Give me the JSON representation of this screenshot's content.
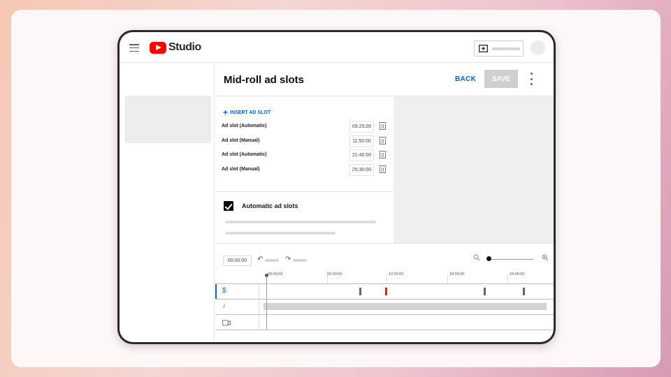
{
  "app": {
    "name": "Studio"
  },
  "header": {
    "title": "Mid-roll ad slots",
    "back_label": "BACK",
    "save_label": "SAVE"
  },
  "ad_slots": {
    "insert_label": "INSERT AD SLOT",
    "items": [
      {
        "label": "Ad slot (Automatic)",
        "time": "09:25:00"
      },
      {
        "label": "Ad slot (Manual)",
        "time": "11:50:00"
      },
      {
        "label": "Ad slot (Automatic)",
        "time": "21:40:00"
      },
      {
        "label": "Ad slot (Manual)",
        "time": "25:30:00"
      }
    ]
  },
  "automatic": {
    "label": "Automatic ad slots",
    "checked": true
  },
  "timeline": {
    "timecode": "00:00:00",
    "ruler": [
      "00:00:00",
      "06:00:00",
      "12:00:00",
      "18:00:00",
      "24:00:00"
    ]
  },
  "colors": {
    "accent": "#065fd4",
    "brand": "#ff0000",
    "active_marker": "#e02020"
  }
}
